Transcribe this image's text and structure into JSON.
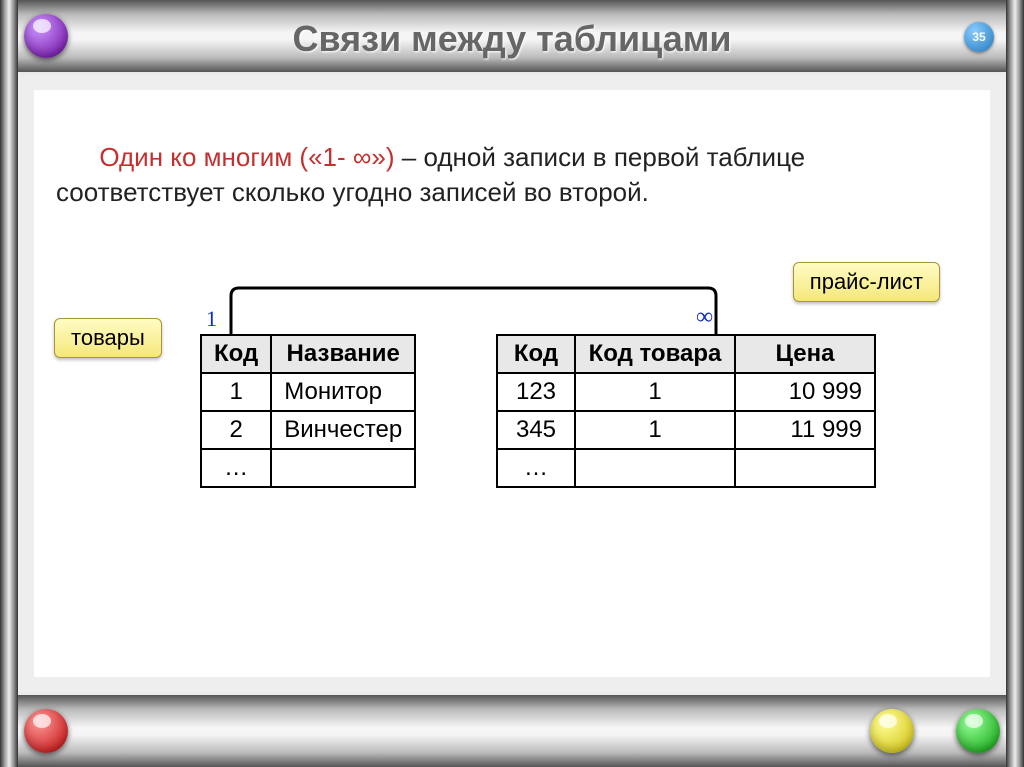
{
  "title": "Связи между таблицами",
  "page_number": "35",
  "para": {
    "highlight": "Один ко многим («1- ∞»)",
    "rest": " – одной записи в первой таблице соответствует сколько угодно записей во второй."
  },
  "tags": {
    "left": "товары",
    "right": "прайс-лист"
  },
  "cardinality": {
    "one": "1",
    "many": "∞"
  },
  "table1": {
    "headers": [
      "Код",
      "Название"
    ],
    "rows": [
      [
        "1",
        "Монитор"
      ],
      [
        "2",
        "Винчестер"
      ],
      [
        "…",
        ""
      ]
    ]
  },
  "table2": {
    "headers": [
      "Код",
      "Код товара",
      "Цена"
    ],
    "rows": [
      [
        "123",
        "1",
        "10 999"
      ],
      [
        "345",
        "1",
        "11 999"
      ],
      [
        "…",
        "",
        ""
      ]
    ]
  }
}
